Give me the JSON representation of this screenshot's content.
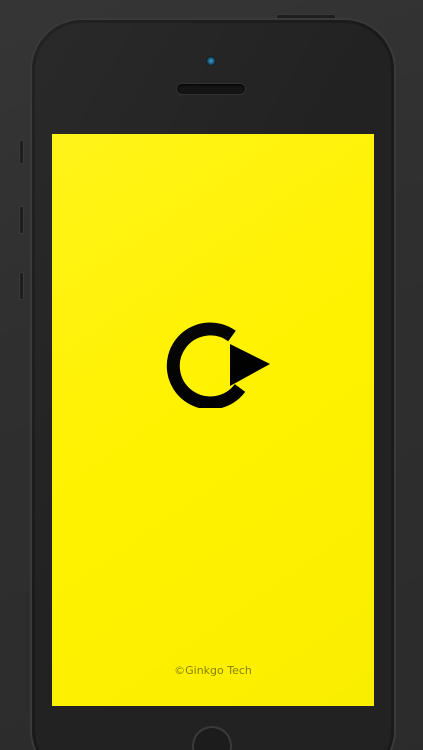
{
  "splash": {
    "background_color": "#fff200",
    "logo_icon": "play-arc-logo",
    "copyright": "©Ginkgo Tech"
  },
  "device": {
    "body_color": "#222222",
    "camera_color": "#3fa7e0"
  }
}
